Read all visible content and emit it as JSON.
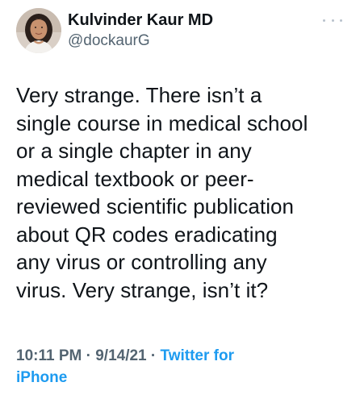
{
  "author": {
    "display_name": "Kulvinder Kaur MD",
    "handle": "@dockaurG",
    "avatar": "profile-photo"
  },
  "more_icon": "ellipsis-icon",
  "tweet": {
    "lines": [
      "Very strange. There isn’t a",
      "single course in medical school",
      "or a single chapter in any",
      "medical textbook or peer-",
      "reviewed scientific publication",
      "about QR codes eradicating",
      "any virus or controlling any",
      "virus. Very strange, isn’t it?"
    ]
  },
  "meta": {
    "time": "10:11 PM",
    "separator": "·",
    "date": "9/14/21",
    "source_line1": "Twitter for",
    "source_line2": "iPhone"
  },
  "colors": {
    "text": "#0f1419",
    "secondary": "#536471",
    "link": "#1d9bf0"
  }
}
